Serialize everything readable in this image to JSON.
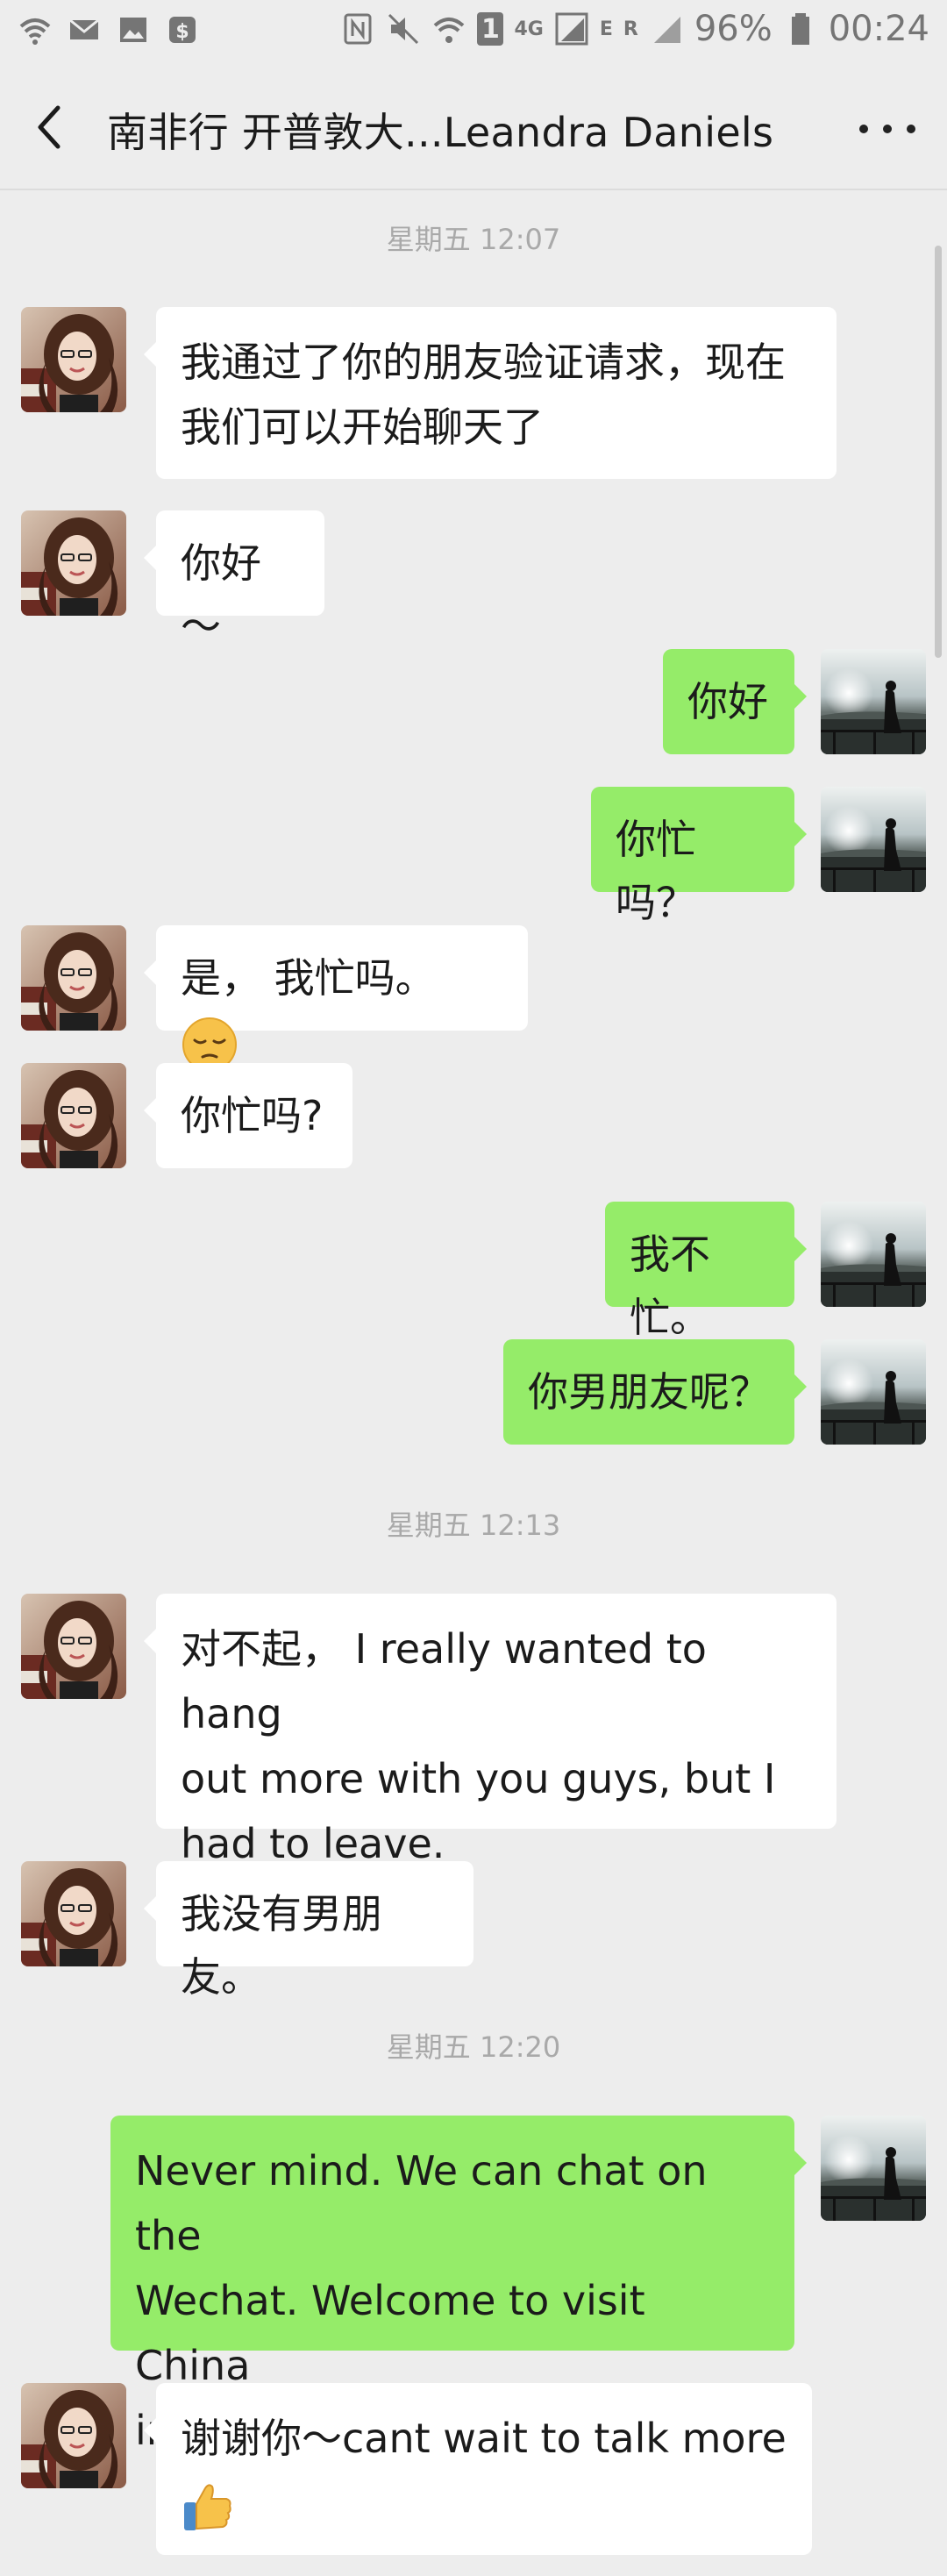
{
  "status_bar": {
    "battery": "96%",
    "time": "00:24",
    "network": "4G",
    "sim_badge": "1",
    "signal_label_e": "E",
    "signal_label_r": "R"
  },
  "header": {
    "title": "南非行 开普敦大...Leandra Daniels"
  },
  "timestamps": {
    "t1": "星期五 12:07",
    "t2": "星期五 12:13",
    "t3": "星期五 12:20"
  },
  "messages": [
    {
      "dir": "in",
      "text": "我通过了你的朋友验证请求，现在\n我们可以开始聊天了"
    },
    {
      "dir": "in",
      "text": "你好～"
    },
    {
      "dir": "out",
      "text": "你好"
    },
    {
      "dir": "out",
      "text": "你忙吗？"
    },
    {
      "dir": "in",
      "text": "是， 我忙吗。",
      "emoji": "pensive-face"
    },
    {
      "dir": "in",
      "text": "你忙吗?"
    },
    {
      "dir": "out",
      "text": "我不忙。"
    },
    {
      "dir": "out",
      "text": "你男朋友呢？"
    },
    {
      "dir": "in",
      "text": "对不起， I really wanted to hang\nout more with you guys, but I\nhad to leave."
    },
    {
      "dir": "in",
      "text": "我没有男朋友。"
    },
    {
      "dir": "out",
      "text": "Never mind. We can chat on the\nWechat. Welcome to visit China\nin the future！"
    },
    {
      "dir": "in",
      "text": "谢谢你～cant wait to talk more",
      "emoji": "thumbs-up"
    }
  ],
  "colors": {
    "background": "#ededed",
    "incoming_bubble": "#ffffff",
    "outgoing_bubble": "#95ec69",
    "timestamp_text": "#a9a9a9"
  }
}
